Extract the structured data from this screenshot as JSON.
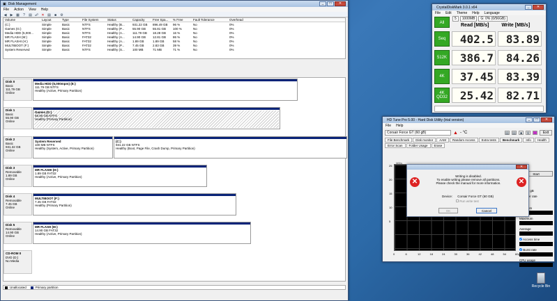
{
  "disk_mgmt": {
    "title": "Disk Management",
    "menu": [
      "File",
      "Action",
      "View",
      "Help"
    ],
    "columns": [
      "Volume",
      "Layout",
      "Type",
      "File System",
      "Status",
      "Capacity",
      "Free Spa...",
      "% Free",
      "Fault Tolerance",
      "Overhead"
    ],
    "rows": [
      [
        "(C:)",
        "Simple",
        "Basic",
        "NTFS",
        "Healthy (B...",
        "931.22 GB",
        "896.49 GB",
        "96 %",
        "No",
        "0%"
      ],
      [
        "Games (G:)",
        "Simple",
        "Basic",
        "NTFS",
        "Healthy (P...",
        "55.90 GB",
        "55.81 GB",
        "100 %",
        "No",
        "0%"
      ],
      [
        "Media HDD (5,000...",
        "Simple",
        "Basic",
        "NTFS",
        "Healthy (A...",
        "111.79 GB",
        "18.28 GB",
        "16 %",
        "No",
        "0%"
      ],
      [
        "MR FLASH (M:)",
        "Simple",
        "Basic",
        "FAT32",
        "Healthy (A...",
        "14.90 GB",
        "12.81 GB",
        "86 %",
        "No",
        "0%"
      ],
      [
        "MR FLASHI (H:)",
        "Simple",
        "Basic",
        "FAT32",
        "Healthy (A...",
        "1.89 GB",
        "1.89 GB",
        "58 %",
        "No",
        "0%"
      ],
      [
        "MULTIBOOT (F:)",
        "Simple",
        "Basic",
        "FAT32",
        "Healthy (P...",
        "7.45 GB",
        "2.83 GB",
        "39 %",
        "No",
        "0%"
      ],
      [
        "System Reserved",
        "Simple",
        "Basic",
        "NTFS",
        "Healthy (S...",
        "100 MB",
        "71 MB",
        "71 %",
        "No",
        "0%"
      ]
    ],
    "disks": [
      {
        "name": "Disk 0",
        "type": "Basic",
        "size": "111.79 GB",
        "state": "Online",
        "parts": [
          {
            "title": "Media HDD (5,000mpm)  (E:)",
            "size": "111.79 GB NTFS",
            "status": "Healthy (Active, Primary Partition)"
          }
        ]
      },
      {
        "name": "Disk 1",
        "type": "Basic",
        "size": "55.90 GB",
        "state": "Online",
        "parts": [
          {
            "title": "Games (G:)",
            "size": "55.90 GB NTFS",
            "status": "Healthy (Primary Partition)"
          }
        ]
      },
      {
        "name": "Disk 2",
        "type": "Basic",
        "size": "931.32 GB",
        "state": "Online",
        "parts": [
          {
            "title": "System Reserved",
            "size": "100 MB NTFS",
            "status": "Healthy (System, Active, Primary Partition)"
          },
          {
            "title": "(C:)",
            "size": "931.22 GB NTFS",
            "status": "Healthy (Boot, Page File, Crash Dump, Primary Partition)"
          }
        ]
      },
      {
        "name": "Disk 3",
        "type": "Removable",
        "size": "1.89 GB",
        "state": "Online",
        "parts": [
          {
            "title": "MR FLASHI  (H:)",
            "size": "1.89 GB FAT32",
            "status": "Healthy (Active, Primary Partition)"
          }
        ]
      },
      {
        "name": "Disk 4",
        "type": "Removable",
        "size": "7.45 GB",
        "state": "Online",
        "parts": [
          {
            "title": "MULTIBOOT  (F:)",
            "size": "7.45 GB FAT32",
            "status": "Healthy (Primary Partition)"
          }
        ]
      },
      {
        "name": "Disk 5",
        "type": "Removable",
        "size": "14.90 GB",
        "state": "Online",
        "parts": [
          {
            "title": "MR FLASH  (M:)",
            "size": "14.90 GB FAT32",
            "status": "Healthy (Active, Primary Partition)"
          }
        ]
      },
      {
        "name": "CD-ROM 0",
        "type": "DVD (D:)",
        "size": "",
        "state": "No Media",
        "parts": []
      }
    ],
    "legend": [
      "Unallocated",
      "Primary partition"
    ]
  },
  "cdm": {
    "title": "CrystalDiskMark 3.0.1 x64",
    "menu": [
      "File",
      "Edit",
      "Theme",
      "Help",
      "Language"
    ],
    "all": "All",
    "count": "5",
    "size": "1000MB",
    "drive": "G: 0% (0/56GB)",
    "read_h": "Read [MB/s]",
    "write_h": "Write [MB/s]",
    "rows": [
      {
        "label": "Seq",
        "read": "402.5",
        "write": "83.89"
      },
      {
        "label": "512K",
        "read": "386.7",
        "write": "84.26"
      },
      {
        "label": "4K",
        "read": "37.45",
        "write": "83.39"
      },
      {
        "label": "4K QD32",
        "read": "25.42",
        "write": "82.71"
      }
    ],
    "colors": {
      "accent": "#34a824"
    }
  },
  "hdtune": {
    "title": "HD Tune Pro 5.00 - Hard Disk Utility (trial version)",
    "menu": [
      "File",
      "Help"
    ],
    "drive": "Corsair Force GT (60 gB)",
    "temp": "- °C",
    "exit": "Exit",
    "tabs": [
      "File Benchmark",
      "Disk monitor",
      "AAM",
      "Random Access",
      "Extra tests",
      "Benchmark",
      "Info",
      "Health",
      "Error Scan",
      "Folder Usage",
      "Erase"
    ],
    "yaxis": [
      "25",
      "20",
      "15",
      "10",
      "5"
    ],
    "xaxis": [
      "0",
      "6",
      "12",
      "18",
      "24",
      "30",
      "36",
      "42",
      "48",
      "54",
      "60gB"
    ],
    "mb_label": "MB/s",
    "start": "Start",
    "stroke_val": "gB",
    "transfer": "Transfer rate",
    "minimum": "Minimum",
    "maximum": "Maximum",
    "average": "Average",
    "access": "Access time",
    "burst": "Burst rate",
    "cpu": "CPU usage",
    "right_input": "22",
    "dialog": {
      "line1": "Writing is disabled.",
      "line2": "To enable writing please remove all partitions.",
      "line3": "Please check the manual for more information.",
      "device_label": "Device:",
      "device": "Corsair Force GT (60 GB)",
      "checkbox": "Run write test",
      "ok": "OK",
      "cancel": "Cancel"
    }
  },
  "desktop": {
    "recycle": "Recycle Bin"
  }
}
